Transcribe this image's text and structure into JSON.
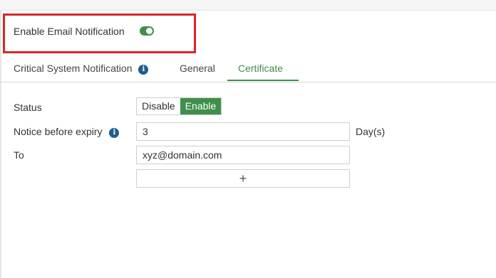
{
  "notification": {
    "enable_label": "Enable Email Notification",
    "enabled": true
  },
  "tabs": [
    {
      "label": "Critical System Notification",
      "info_icon": "i"
    },
    {
      "label": "General"
    },
    {
      "label": "Certificate",
      "active": true
    }
  ],
  "form": {
    "status": {
      "label": "Status",
      "options": [
        "Disable",
        "Enable"
      ],
      "selected": "Enable"
    },
    "notice": {
      "label": "Notice before expiry",
      "info_icon": "i",
      "value": "3",
      "unit": "Day(s)"
    },
    "to": {
      "label": "To",
      "value": "xyz@domain.com",
      "add_symbol": "+"
    }
  },
  "colors": {
    "accent": "#3f8f4a",
    "info": "#1d5d91",
    "highlight": "#d9252a"
  }
}
